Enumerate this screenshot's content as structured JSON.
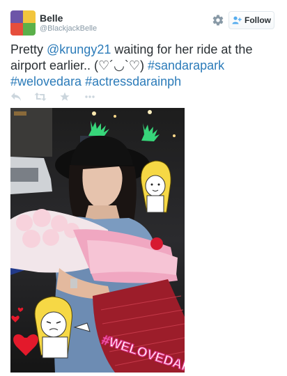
{
  "user": {
    "display_name": "Belle",
    "handle": "@BlackjackBelle"
  },
  "follow_button": {
    "label": "Follow"
  },
  "tweet": {
    "segments": [
      {
        "text": "Pretty ",
        "link": false
      },
      {
        "text": "@krungy21",
        "link": true
      },
      {
        "text": " waiting for her ride at the airport earlier.. (♡´◡`♡) ",
        "link": false
      },
      {
        "text": "#sandarapark",
        "link": true
      },
      {
        "text": " ",
        "link": false
      },
      {
        "text": "#welovedara",
        "link": true
      },
      {
        "text": " ",
        "link": false
      },
      {
        "text": "#actressdarainph",
        "link": true
      }
    ]
  },
  "actions": [
    {
      "name": "reply-icon"
    },
    {
      "name": "retweet-icon"
    },
    {
      "name": "favorite-icon"
    },
    {
      "name": "more-icon"
    }
  ],
  "photo": {
    "overlay_text": "#WELOVEDARA"
  },
  "colors": {
    "link": "#2b7bb9",
    "text": "#292f33",
    "muted": "#8899a6",
    "action": "#ccd6dd"
  }
}
